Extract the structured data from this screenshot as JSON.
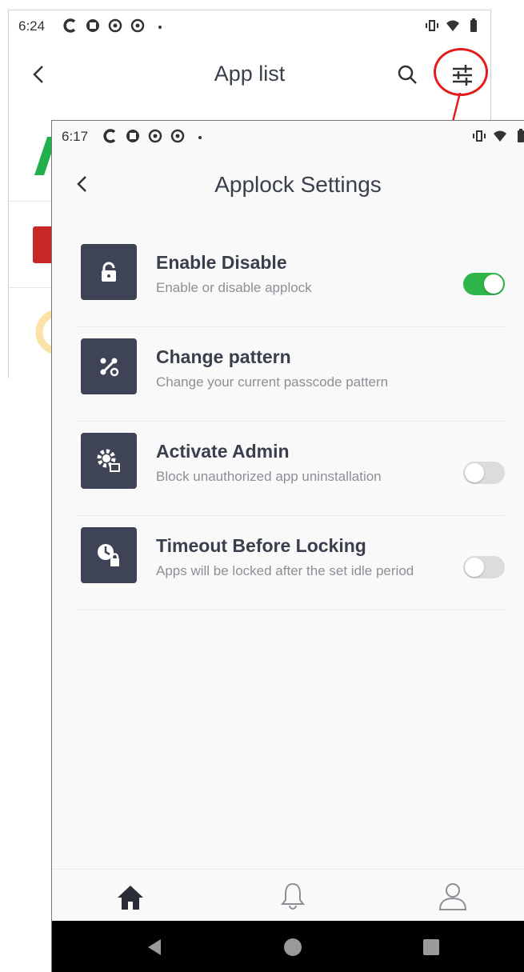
{
  "back_screen": {
    "status": {
      "time": "6:24"
    },
    "title": "App list"
  },
  "front_screen": {
    "status": {
      "time": "6:17"
    },
    "title": "Applock Settings",
    "settings": [
      {
        "title": "Enable Disable",
        "subtitle": "Enable or disable applock",
        "icon": "padlock-icon",
        "toggle": "on"
      },
      {
        "title": "Change pattern",
        "subtitle": "Change your current passcode pattern",
        "icon": "pattern-icon",
        "toggle": null
      },
      {
        "title": "Activate Admin",
        "subtitle": "Block unauthorized app uninstallation",
        "icon": "admin-gear-icon",
        "toggle": "off"
      },
      {
        "title": "Timeout Before Locking",
        "subtitle": "Apps will be locked after the set idle period",
        "icon": "clock-lock-icon",
        "toggle": "off"
      }
    ],
    "bottom_nav": [
      "home-icon",
      "bell-icon",
      "user-icon"
    ]
  },
  "colors": {
    "toggle_on": "#2fb54a",
    "icon_tile": "#3e4456",
    "highlight": "#e11d1d"
  }
}
